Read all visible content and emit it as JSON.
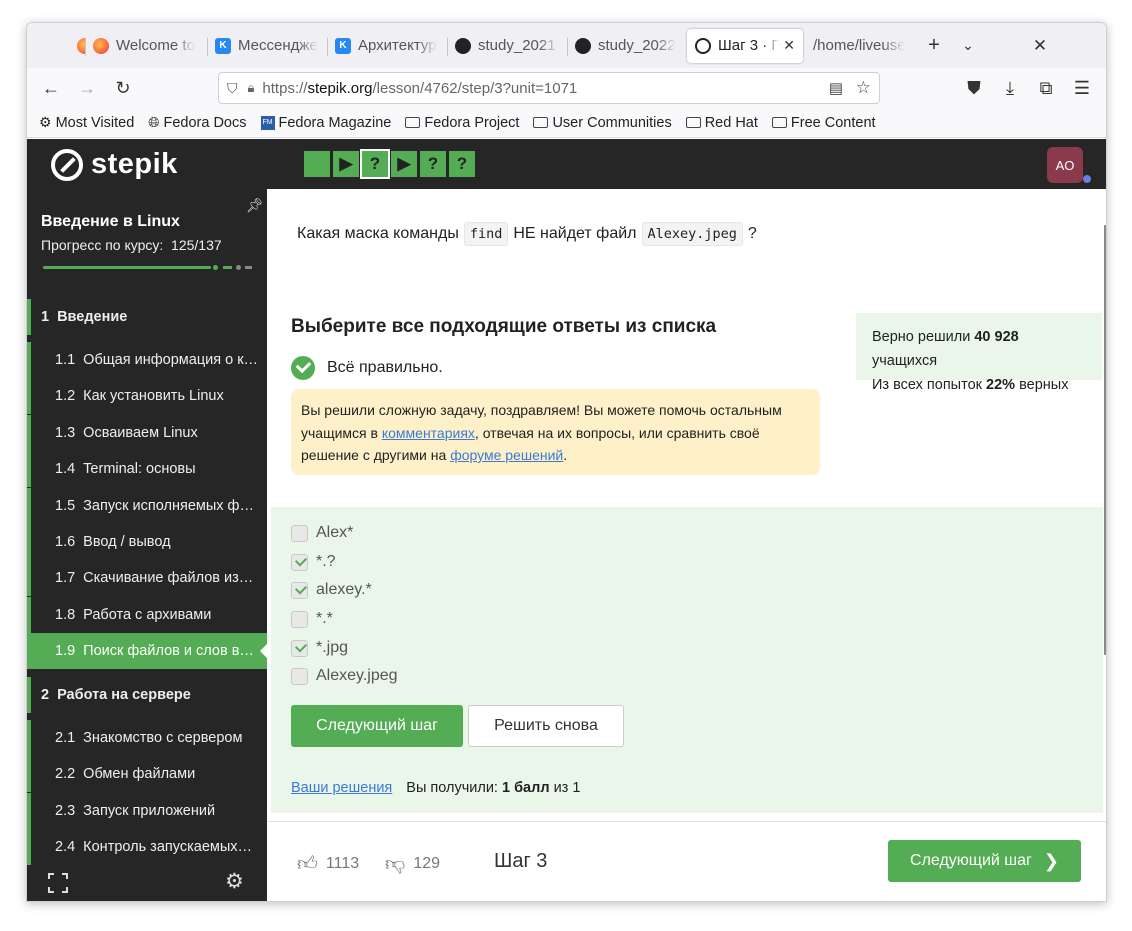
{
  "browser": {
    "tabs": [
      {
        "label": "",
        "icon": "firefox-icon"
      },
      {
        "label": "Welcome to",
        "icon": "firefox-icon"
      },
      {
        "label": "Мессендже",
        "icon": "vk-icon"
      },
      {
        "label": "Архитектур",
        "icon": "vk-icon"
      },
      {
        "label": "study_2021-",
        "icon": "github-icon"
      },
      {
        "label": "study_2022",
        "icon": "github-icon"
      },
      {
        "label": "Шаг 3 · По",
        "icon": "stepik-icon",
        "active": true
      },
      {
        "label": "/home/liveuser",
        "icon": ""
      }
    ],
    "url": {
      "prefix": "https://",
      "host": "stepik.org",
      "path": "/lesson/4762/step/3?unit=1071"
    },
    "bookmarks": [
      {
        "label": "Most Visited",
        "icon": "gear-icon"
      },
      {
        "label": "Fedora Docs",
        "icon": "globe-icon"
      },
      {
        "label": "Fedora Magazine",
        "icon": "fedora-magazine-icon"
      },
      {
        "label": "Fedora Project",
        "icon": "folder-icon"
      },
      {
        "label": "User Communities",
        "icon": "folder-icon"
      },
      {
        "label": "Red Hat",
        "icon": "folder-icon"
      },
      {
        "label": "Free Content",
        "icon": "folder-icon"
      }
    ]
  },
  "header": {
    "logo": "stepik",
    "avatar": "AO",
    "steps": [
      "",
      "▶",
      "?",
      "▶",
      "?",
      "?"
    ]
  },
  "sidebar": {
    "course_title": "Введение в Linux",
    "progress_label": "Прогресс по курсу:",
    "progress_value": "125/137",
    "items": [
      {
        "num": "1",
        "label": "Введение",
        "type": "section"
      },
      {
        "num": "1.1",
        "label": "Общая информация о к…",
        "type": "lesson"
      },
      {
        "num": "1.2",
        "label": "Как установить Linux",
        "type": "lesson"
      },
      {
        "num": "1.3",
        "label": "Осваиваем Linux",
        "type": "lesson"
      },
      {
        "num": "1.4",
        "label": "Terminal: основы",
        "type": "lesson"
      },
      {
        "num": "1.5",
        "label": "Запуск исполняемых ф…",
        "type": "lesson"
      },
      {
        "num": "1.6",
        "label": "Ввод / вывод",
        "type": "lesson"
      },
      {
        "num": "1.7",
        "label": "Скачивание файлов из…",
        "type": "lesson"
      },
      {
        "num": "1.8",
        "label": "Работа с архивами",
        "type": "lesson"
      },
      {
        "num": "1.9",
        "label": "Поиск файлов и слов в…",
        "type": "lesson",
        "active": true
      },
      {
        "num": "2",
        "label": "Работа на сервере",
        "type": "section"
      },
      {
        "num": "2.1",
        "label": "Знакомство с сервером",
        "type": "lesson"
      },
      {
        "num": "2.2",
        "label": "Обмен файлами",
        "type": "lesson"
      },
      {
        "num": "2.3",
        "label": "Запуск приложений",
        "type": "lesson"
      },
      {
        "num": "2.4",
        "label": "Контроль запускаемых…",
        "type": "lesson"
      }
    ]
  },
  "main": {
    "question_pre": "Какая маска команды",
    "question_code1": "find",
    "question_mid": "НЕ найдет файл",
    "question_code2": "Alexey.jpeg",
    "question_post": "?",
    "heading": "Выберите все подходящие ответы из списка",
    "stats": {
      "line1_pre": "Верно решили",
      "line1_num": "40 928",
      "line1_post": "учащихся",
      "line2_pre": "Из всех попыток",
      "line2_num": "22%",
      "line2_post": "верных"
    },
    "result": "Всё правильно.",
    "congrats": {
      "part1": "Вы решили сложную задачу, поздравляем! Вы можете помочь остальным учащимся в ",
      "link1": "комментариях",
      "part2": ", отвечая на их вопросы, или сравнить своё решение с другими на ",
      "link2": "форуме решений",
      "part3": "."
    },
    "options": [
      {
        "label": "Alex*",
        "checked": false
      },
      {
        "label": "*.?",
        "checked": true
      },
      {
        "label": "alexey.*",
        "checked": true
      },
      {
        "label": "*.*",
        "checked": false
      },
      {
        "label": "*.jpg",
        "checked": true
      },
      {
        "label": "Alexey.jpeg",
        "checked": false
      }
    ],
    "next_button": "Следующий шаг",
    "retry_button": "Решить снова",
    "your_solutions": "Ваши решения",
    "score_pre": "Вы получили:",
    "score_bold": "1 балл",
    "score_post": "из 1"
  },
  "footer": {
    "likes": "1113",
    "dislikes": "129",
    "step_label": "Шаг 3",
    "next_button": "Следующий шаг"
  },
  "colors": {
    "accent": "#54ad54",
    "dark": "#262626",
    "congrats_bg": "#fef0c8",
    "answers_bg": "#eaf6ea"
  }
}
